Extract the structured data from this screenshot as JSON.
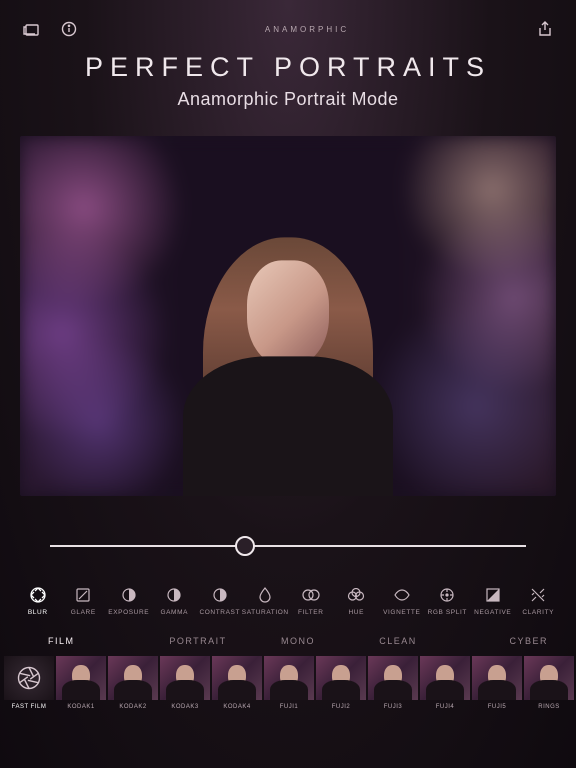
{
  "brand": "ANAMORPHIC",
  "hero": {
    "title": "PERFECT PORTRAITS",
    "subtitle": "Anamorphic Portrait Mode"
  },
  "slider": {
    "value": 41
  },
  "tools": [
    {
      "id": "blur",
      "label": "BLUR",
      "active": true
    },
    {
      "id": "glare",
      "label": "GLARE",
      "active": false
    },
    {
      "id": "exposure",
      "label": "EXPOSURE",
      "active": false
    },
    {
      "id": "gamma",
      "label": "GAMMA",
      "active": false
    },
    {
      "id": "contrast",
      "label": "CONTRAST",
      "active": false
    },
    {
      "id": "saturation",
      "label": "SATURATION",
      "active": false
    },
    {
      "id": "filter",
      "label": "FILTER",
      "active": false
    },
    {
      "id": "hue",
      "label": "HUE",
      "active": false
    },
    {
      "id": "vignette",
      "label": "VIGNETTE",
      "active": false
    },
    {
      "id": "rgbsplit",
      "label": "RGB SPLIT",
      "active": false
    },
    {
      "id": "negative",
      "label": "NEGATIVE",
      "active": false
    },
    {
      "id": "clarity",
      "label": "CLARITY",
      "active": false
    }
  ],
  "categories": [
    {
      "id": "film",
      "label": "FILM",
      "active": true
    },
    {
      "id": "portrait",
      "label": "PORTRAIT",
      "active": false
    },
    {
      "id": "mono",
      "label": "MONO",
      "active": false
    },
    {
      "id": "clean",
      "label": "CLEAN",
      "active": false
    },
    {
      "id": "cyber",
      "label": "CYBER",
      "active": false
    }
  ],
  "presets": [
    {
      "id": "fastfilm",
      "label": "FAST FILM",
      "active": true
    },
    {
      "id": "kodak1",
      "label": "KODAK1",
      "active": false
    },
    {
      "id": "kodak2",
      "label": "KODAK2",
      "active": false
    },
    {
      "id": "kodak3",
      "label": "KODAK3",
      "active": false
    },
    {
      "id": "kodak4",
      "label": "KODAK4",
      "active": false
    },
    {
      "id": "fuji1",
      "label": "FUJI1",
      "active": false
    },
    {
      "id": "fuji2",
      "label": "FUJI2",
      "active": false
    },
    {
      "id": "fuji3",
      "label": "FUJI3",
      "active": false
    },
    {
      "id": "fuji4",
      "label": "FUJI4",
      "active": false
    },
    {
      "id": "fuji5",
      "label": "FUJI5",
      "active": false
    },
    {
      "id": "rings",
      "label": "RINGS",
      "active": false
    }
  ],
  "icons": {
    "albums": "albums-icon",
    "info": "info-icon",
    "share": "share-icon"
  }
}
